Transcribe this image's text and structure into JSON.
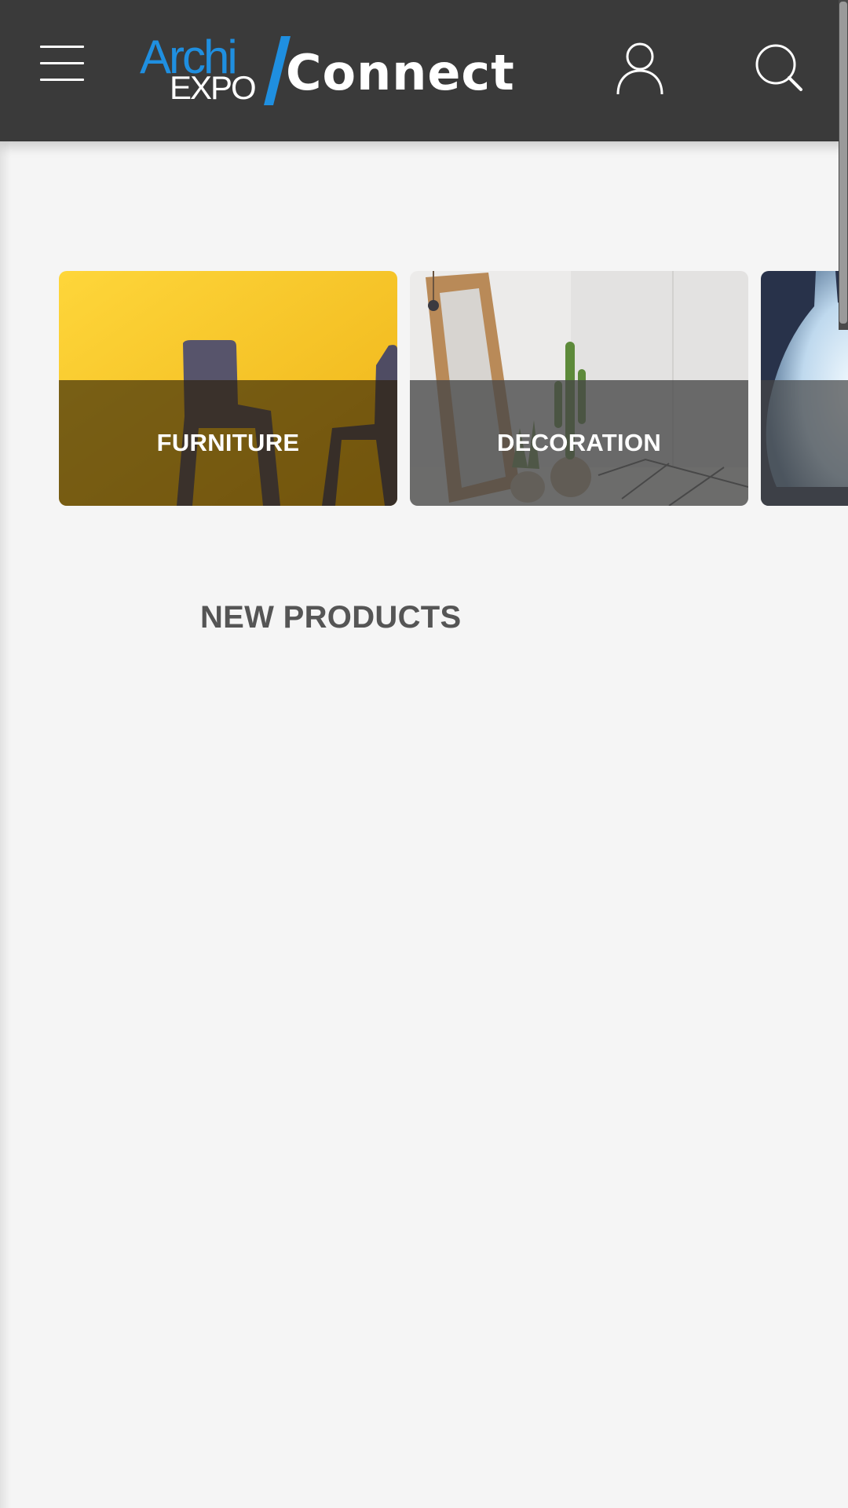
{
  "header": {
    "logo": {
      "archi": "Archi",
      "expo": "EXPO",
      "connect": "Connect",
      "accent_color": "#1f8fe0"
    },
    "menu_icon": "hamburger-menu-icon",
    "account_icon": "user-icon",
    "search_icon": "search-icon",
    "background": "#3a3a3a"
  },
  "categories": [
    {
      "label": "FURNITURE",
      "image": "yellow wall with dark chairs"
    },
    {
      "label": "DECORATION",
      "image": "wooden mirror with cacti"
    },
    {
      "label": "",
      "image": "white pendant lamp"
    }
  ],
  "sections": {
    "new_products_title": "NEW PRODUCTS"
  }
}
